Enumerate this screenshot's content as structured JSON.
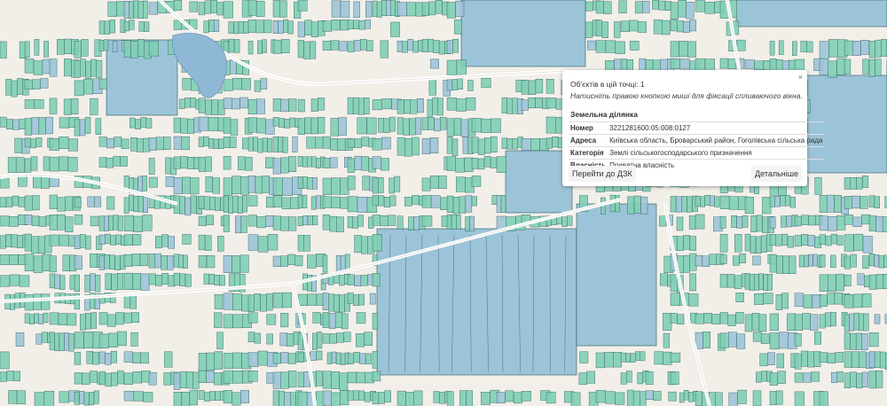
{
  "popup": {
    "close": "×",
    "objects_count": "Об'єктів в цій точці: 1",
    "hint": "Натисніть правою кнопкою миші для фіксації спливаючого вікна.",
    "section_title": "Земельна ділянка",
    "rows": [
      {
        "key": "Номер",
        "value": "3221281600:05:008:0127"
      },
      {
        "key": "Адреса",
        "value": "Київська область, Броварський район, Гоголівська сільська рада"
      },
      {
        "key": "Категорія",
        "value": "Землі сільськогосподарського призначення"
      },
      {
        "key": "Власність",
        "value": "Приватна власність"
      }
    ],
    "buttons": {
      "dzk": "Перейти до ДЗК",
      "details": "Детальніше"
    }
  },
  "colors": {
    "parcel": "#7fceb5",
    "parcel_blue": "#9cc4d8",
    "background": "#f2efe9",
    "outline": "#2e5a5a"
  }
}
